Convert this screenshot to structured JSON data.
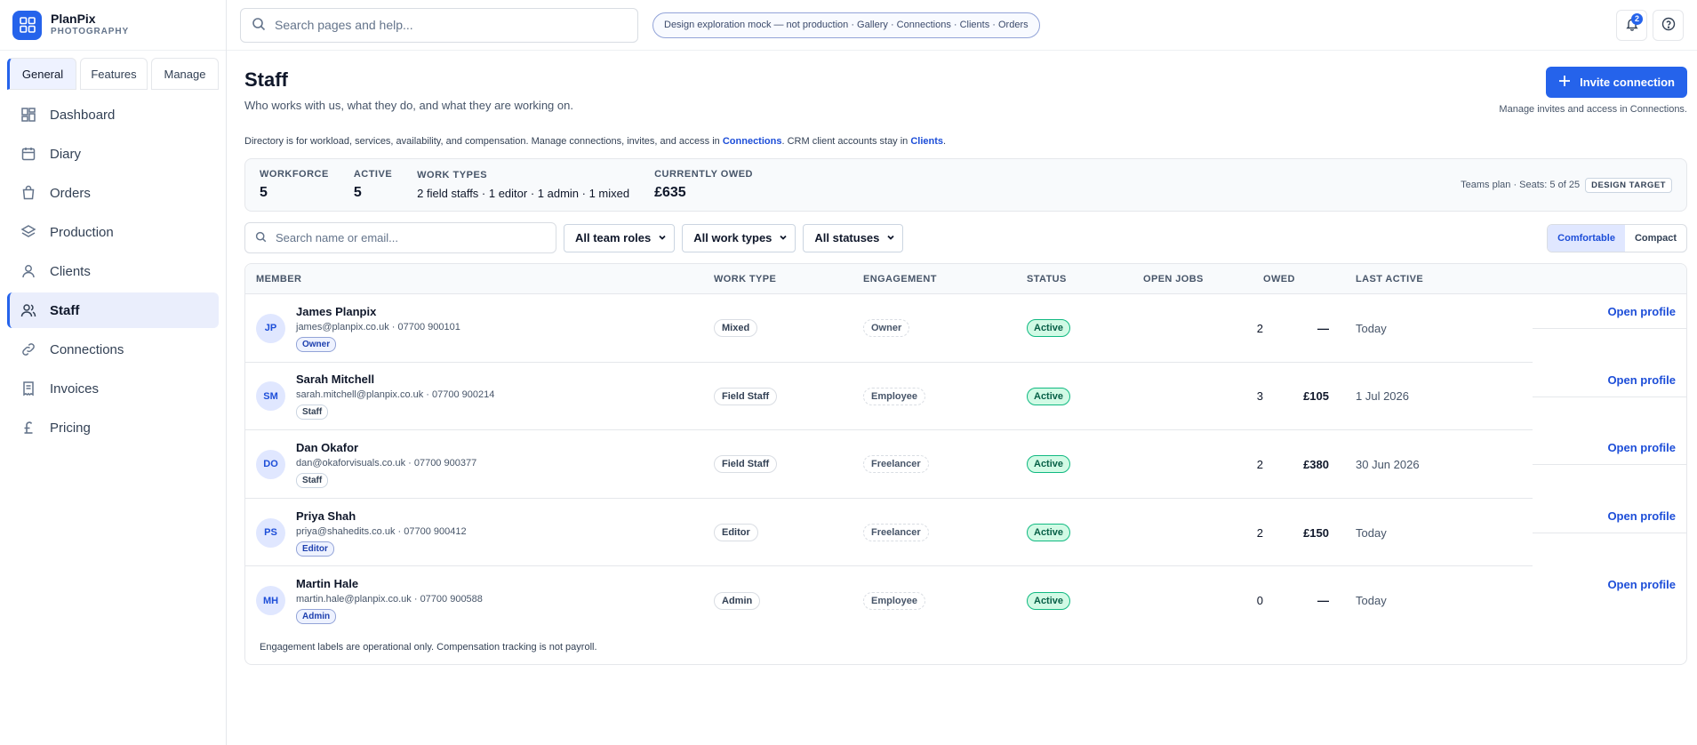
{
  "brand": {
    "name": "PlanPix",
    "sub": "PHOTOGRAPHY",
    "accent": "#2563eb"
  },
  "sidebar": {
    "tabs": [
      "General",
      "Features",
      "Manage"
    ],
    "items": [
      {
        "label": "Dashboard",
        "icon": "dashboard-icon"
      },
      {
        "label": "Diary",
        "icon": "calendar-icon"
      },
      {
        "label": "Orders",
        "icon": "bag-icon"
      },
      {
        "label": "Production",
        "icon": "layers-icon"
      },
      {
        "label": "Clients",
        "icon": "user-icon"
      },
      {
        "label": "Staff",
        "icon": "users-icon"
      },
      {
        "label": "Connections",
        "icon": "link-icon"
      },
      {
        "label": "Invoices",
        "icon": "receipt-icon"
      },
      {
        "label": "Pricing",
        "icon": "pound-icon"
      }
    ]
  },
  "topbar": {
    "search_placeholder": "Search pages and help...",
    "mock_pill": "Design exploration mock — not production · Gallery · Connections · Clients · Orders",
    "notif_count": "2"
  },
  "page": {
    "title": "Staff",
    "subtitle": "Who works with us, what they do, and what they are working on.",
    "invite_label": "Invite connection",
    "invite_note": "Manage invites and access in Connections.",
    "dir_note_a": "Directory is for workload, services, availability, and compensation. Manage connections, invites, and access in ",
    "dir_note_link1": "Connections",
    "dir_note_b": ". CRM client accounts stay in ",
    "dir_note_link2": "Clients",
    "dir_note_c": "."
  },
  "stats": {
    "workforce_label": "WORKFORCE",
    "workforce": "5",
    "active_label": "ACTIVE",
    "active": "5",
    "work_types_label": "WORK TYPES",
    "work_types": "2 field staffs · 1 editor · 1 admin · 1 mixed",
    "owed_label": "CURRENTLY OWED",
    "owed": "£635",
    "plan": "Teams plan · Seats: 5 of 25",
    "plan_tag": "DESIGN TARGET"
  },
  "filters": {
    "search_placeholder": "Search name or email...",
    "roles": "All team roles",
    "work_types": "All work types",
    "statuses": "All statuses",
    "comfortable": "Comfortable",
    "compact": "Compact"
  },
  "table": {
    "headers": {
      "member": "MEMBER",
      "work": "WORK TYPE",
      "engagement": "ENGAGEMENT",
      "status": "STATUS",
      "jobs": "OPEN JOBS",
      "owed": "OWED",
      "last": "LAST ACTIVE"
    },
    "open_label": "Open profile",
    "rows": [
      {
        "initials": "JP",
        "name": "James Planpix",
        "contact": "james@planpix.co.uk · 07700 900101",
        "role": "Owner",
        "work": "Mixed",
        "engagement": "Owner",
        "status": "Active",
        "jobs": "2",
        "owed": "—",
        "last": "Today"
      },
      {
        "initials": "SM",
        "name": "Sarah Mitchell",
        "contact": "sarah.mitchell@planpix.co.uk · 07700 900214",
        "role": "Staff",
        "work": "Field Staff",
        "engagement": "Employee",
        "status": "Active",
        "jobs": "3",
        "owed": "£105",
        "last": "1 Jul 2026"
      },
      {
        "initials": "DO",
        "name": "Dan Okafor",
        "contact": "dan@okaforvisuals.co.uk · 07700 900377",
        "role": "Staff",
        "work": "Field Staff",
        "engagement": "Freelancer",
        "status": "Active",
        "jobs": "2",
        "owed": "£380",
        "last": "30 Jun 2026"
      },
      {
        "initials": "PS",
        "name": "Priya Shah",
        "contact": "priya@shahedits.co.uk · 07700 900412",
        "role": "Editor",
        "work": "Editor",
        "engagement": "Freelancer",
        "status": "Active",
        "jobs": "2",
        "owed": "£150",
        "last": "Today"
      },
      {
        "initials": "MH",
        "name": "Martin Hale",
        "contact": "martin.hale@planpix.co.uk · 07700 900588",
        "role": "Admin",
        "work": "Admin",
        "engagement": "Employee",
        "status": "Active",
        "jobs": "0",
        "owed": "—",
        "last": "Today"
      }
    ],
    "footnote": "Engagement labels are operational only. Compensation tracking is not payroll."
  }
}
